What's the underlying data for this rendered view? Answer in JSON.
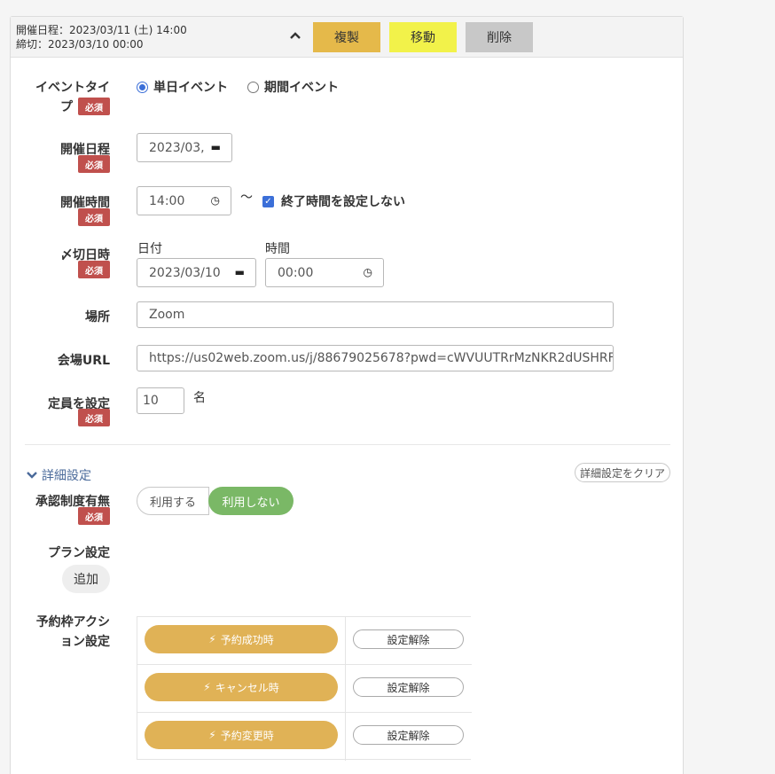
{
  "header": {
    "schedule_line": "開催日程：2023/03/11 (土) 14:00",
    "deadline_line": "締切：2023/03/10 00:00",
    "duplicate_label": "複製",
    "move_label": "移動",
    "delete_label": "削除",
    "duplicate_color": "#e5b94a",
    "move_color": "#f2f24a",
    "delete_color": "#c8c8c8"
  },
  "required_badge": "必須",
  "event_type": {
    "label_line1": "イベントタイ",
    "label_line2": "プ",
    "options": [
      "単日イベント",
      "期間イベント"
    ],
    "selected": "単日イベント"
  },
  "date": {
    "label": "開催日程",
    "value": "2023/03,"
  },
  "time": {
    "label": "開催時間",
    "value": "14:00",
    "tilde": "〜",
    "no_end_label": "終了時間を設定しない",
    "no_end_checked": true
  },
  "deadline": {
    "label": "〆切日時",
    "date_caption": "日付",
    "time_caption": "時間",
    "date_value": "2023/03/10",
    "time_value": "00:00"
  },
  "location": {
    "label": "場所",
    "value": "Zoom"
  },
  "venue_url": {
    "label": "会場URL",
    "value": "https://us02web.zoom.us/j/88679025678?pwd=cWVUUTRrMzNKR2dUSHRF"
  },
  "capacity": {
    "label": "定員を設定",
    "value": "10",
    "unit": "名"
  },
  "details": {
    "toggle_label": "詳細設定",
    "clear_label": "詳細設定をクリア",
    "approval_label": "承認制度有無",
    "approval_options": [
      "利用する",
      "利用しない"
    ],
    "approval_selected": "利用しない",
    "plan_label": "プラン設定",
    "plan_add_label": "追加",
    "actions_label_line1": "予約枠アクシ",
    "actions_label_line2": "ョン設定",
    "actions": [
      {
        "label": "予約成功時",
        "clear": "設定解除"
      },
      {
        "label": "キャンセル時",
        "clear": "設定解除"
      },
      {
        "label": "予約変更時",
        "clear": "設定解除"
      }
    ]
  }
}
